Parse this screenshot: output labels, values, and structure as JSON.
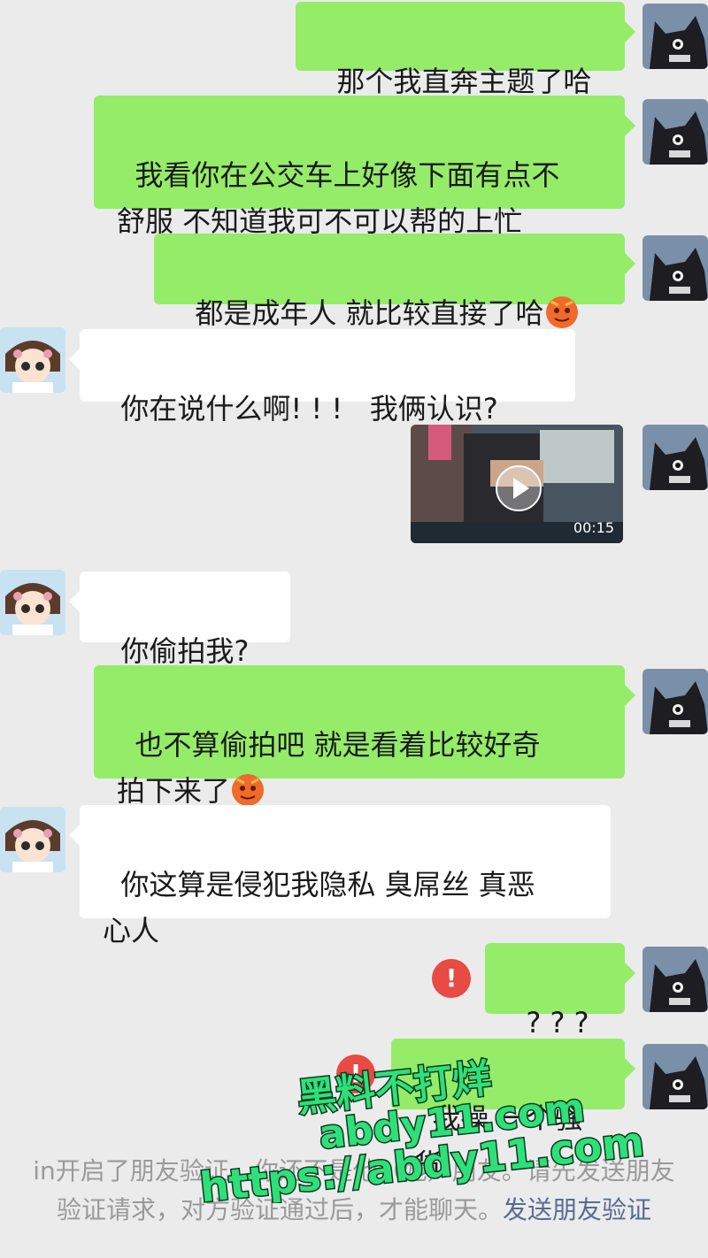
{
  "messages": [
    {
      "text": "那个我直奔主题了哈"
    },
    {
      "text": "我看你在公交车上好像下面有点不\n舒服 不知道我可不可以帮的上忙"
    },
    {
      "text": "都是成年人 就比较直接了哈"
    },
    {
      "text": "你在说什么啊! ! !   我俩认识?"
    },
    {
      "video_duration": "00:15"
    },
    {
      "text": "你偷拍我?"
    },
    {
      "text": "也不算偷拍吧 就是看着比较好奇\n拍下来了"
    },
    {
      "text": "你这算是侵犯我隐私 臭屌丝 真恶\n心人"
    },
    {
      "text": "? ? ?"
    },
    {
      "text": "我操 一个骚货"
    }
  ],
  "alert_icon": "!",
  "system_note": {
    "text": "in开启了朋友验证，你还不是他（她）朋友。请先发送朋友验证请求，对方验证通过后，才能聊天。",
    "link": "发送朋友验证"
  },
  "watermark": {
    "line1": "黑料不打烊",
    "line2": "abdy11.com",
    "line3": "https://abdy11.com"
  },
  "colors": {
    "outgoing_bubble": "#95ec69",
    "incoming_bubble": "#ffffff",
    "background": "#ebebeb",
    "alert": "#e84a44",
    "link": "#576b95",
    "watermark": "#2fe07a"
  }
}
